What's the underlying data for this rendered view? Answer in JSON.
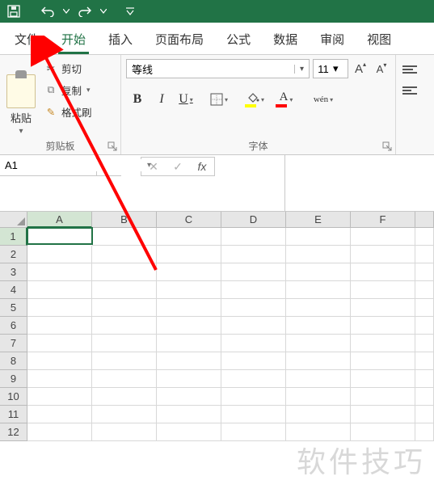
{
  "titlebar": {
    "save": "保存",
    "undo": "撤销",
    "redo": "恢复"
  },
  "tabs": {
    "file": "文件",
    "home": "开始",
    "insert": "插入",
    "page_layout": "页面布局",
    "formulas": "公式",
    "data": "数据",
    "review": "审阅",
    "view": "视图"
  },
  "ribbon": {
    "clipboard": {
      "paste": "粘贴",
      "cut": "剪切",
      "copy": "复制",
      "format_painter": "格式刷",
      "group_label": "剪贴板"
    },
    "font": {
      "name": "等线",
      "size": "11",
      "bold": "B",
      "italic": "I",
      "underline": "U",
      "font_color_letter": "A",
      "phonetic": "wén",
      "group_label": "字体",
      "increase_glyph": "A",
      "decrease_glyph": "A"
    }
  },
  "formula_bar": {
    "name_box": "A1",
    "fx_label": "fx"
  },
  "grid": {
    "cols": [
      "A",
      "B",
      "C",
      "D",
      "E",
      "F"
    ],
    "rows": [
      "1",
      "2",
      "3",
      "4",
      "5",
      "6",
      "7",
      "8",
      "9",
      "10",
      "11",
      "12"
    ]
  },
  "annotations": {
    "arrow_color": "#ff0000",
    "watermark": "软件技巧"
  }
}
